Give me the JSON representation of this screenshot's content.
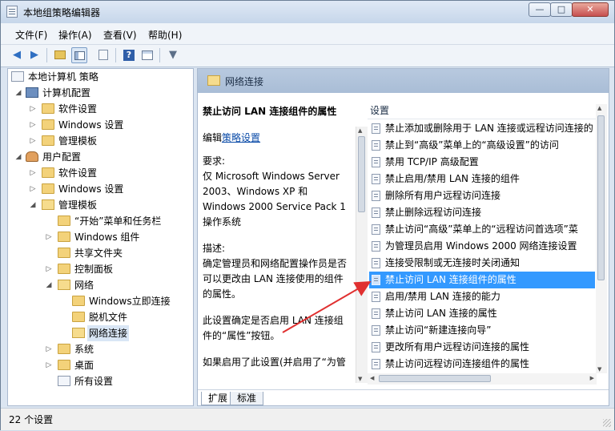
{
  "window": {
    "title": "本地组策略编辑器",
    "min": "—",
    "max": "□",
    "close": "✕"
  },
  "menu": [
    "文件(F)",
    "操作(A)",
    "查看(V)",
    "帮助(H)"
  ],
  "toolbar": {
    "icons": [
      "back-arrow-icon",
      "forward-arrow-icon",
      "up-folder-icon",
      "show-hide-tree-icon",
      "export-list-icon",
      "help-icon",
      "properties-icon",
      "filter-icon"
    ]
  },
  "tree": {
    "root": "本地计算机 策略",
    "computer": "计算机配置",
    "computer_children": [
      "软件设置",
      "Windows 设置",
      "管理模板"
    ],
    "user": "用户配置",
    "user_children": [
      "软件设置",
      "Windows 设置",
      "管理模板"
    ],
    "admin_children": [
      "“开始”菜单和任务栏",
      "Windows 组件",
      "共享文件夹",
      "控制面板",
      "网络"
    ],
    "network_children": [
      "Windows立即连接",
      "脱机文件",
      "网络连接"
    ],
    "after_network": [
      "系统",
      "桌面",
      "所有设置"
    ]
  },
  "right_header": "网络连接",
  "description": {
    "title": "禁止访问 LAN 连接组件的属性",
    "edit_prefix": "编辑",
    "edit_link": "策略设置",
    "requirements_label": "要求:",
    "requirements": "仅 Microsoft Windows Server 2003、Windows XP 和 Windows 2000 Service Pack 1 操作系统",
    "desc_label": "描述:",
    "desc_text": "确定管理员和网络配置操作员是否可以更改由 LAN 连接使用的组件的属性。",
    "desc_text2": "此设置确定是否启用 LAN 连接组件的“属性”按钮。",
    "desc_text3": "如果启用了此设置(并启用了“为管"
  },
  "list": {
    "header": "设置",
    "rows": [
      "禁止添加或删除用于 LAN 连接或远程访问连接的",
      "禁止到“高级”菜单上的“高级设置”的访问",
      "禁用 TCP/IP 高级配置",
      "禁止启用/禁用 LAN 连接的组件",
      "删除所有用户远程访问连接",
      "禁止删除远程访问连接",
      "禁止访问“高级”菜单上的“远程访问首选项”菜",
      "为管理员启用 Windows 2000 网络连接设置",
      "连接受限制或无连接时关闭通知",
      "禁止访问 LAN 连接组件的属性",
      "启用/禁用 LAN 连接的能力",
      "禁止访问 LAN 连接的属性",
      "禁止访问“新建连接向导”",
      "更改所有用户远程访问连接的属性",
      "禁止访问远程访问连接组件的属性"
    ],
    "selected_index": 9
  },
  "tabs": [
    "扩展",
    "标准"
  ],
  "status": "22 个设置",
  "colors": {
    "selection": "#3399ff",
    "annotation_arrow": "#e03030"
  }
}
